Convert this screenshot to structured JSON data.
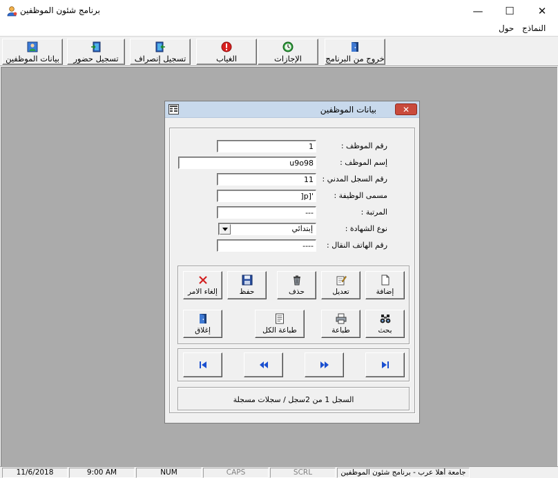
{
  "window": {
    "title": "برنامج شئون الموظفين",
    "minimize_glyph": "—",
    "maximize_glyph": "☐",
    "close_glyph": "✕"
  },
  "menu": {
    "items": [
      {
        "label": "النماذج"
      },
      {
        "label": "حول"
      }
    ]
  },
  "toolbar": {
    "buttons": [
      {
        "label": "بيانات الموظفين",
        "icon": "employee-data-icon"
      },
      {
        "label": "تسجيل حضور",
        "icon": "check-in-icon"
      },
      {
        "label": "تسجيل إنصراف",
        "icon": "check-out-icon"
      },
      {
        "label": "الغياب",
        "icon": "absence-icon"
      },
      {
        "label": "الإجازات",
        "icon": "vacations-icon"
      },
      {
        "label": "خروج من البرنامج",
        "icon": "exit-icon"
      }
    ]
  },
  "dialog": {
    "title": "بيانات الموظفين",
    "close_glyph": "✕",
    "fields": {
      "employee_id": {
        "label": "رقم الموظف :",
        "value": "1"
      },
      "employee_name": {
        "label": "إسم الموظف :",
        "value": "u9o98"
      },
      "civil_id": {
        "label": "رقم السجل المدني :",
        "value": "11"
      },
      "job_title": {
        "label": "مسمى الوظيفة :",
        "value": "]p]'"
      },
      "rank": {
        "label": "المرتبة :",
        "value": "---"
      },
      "certificate_type": {
        "label": "نوع الشهادة :",
        "value": "إبتدائي"
      },
      "mobile": {
        "label": "رقم الهاتف النقال :",
        "value": "----"
      }
    },
    "actions": {
      "add": "إضافة",
      "edit": "تعديل",
      "delete": "حذف",
      "save": "حفظ",
      "cancel": "إلغاء الامر",
      "search": "بحث",
      "print": "طباعة",
      "print_all": "طباعة الكل",
      "close": "إغلاق"
    },
    "navigation": [
      "first-record-icon",
      "previous-record-icon",
      "next-record-icon",
      "last-record-icon"
    ],
    "record_status": "السجل 1 من 2سجل / سجلات مسجلة"
  },
  "statusbar": {
    "app_label": "جامعة أهلا عرب - برنامج شئون الموظفين",
    "scrl": "SCRL",
    "caps": "CAPS",
    "num": "NUM",
    "time": "9:00 AM",
    "date": "11/6/2018"
  },
  "colors": {
    "mdi_background": "#ababab",
    "dialog_titlebar": "#c8d9ec",
    "dialog_close": "#c94a3c",
    "cancel_icon": "#d21f1f",
    "nav_arrows": "#1a4fd0"
  }
}
